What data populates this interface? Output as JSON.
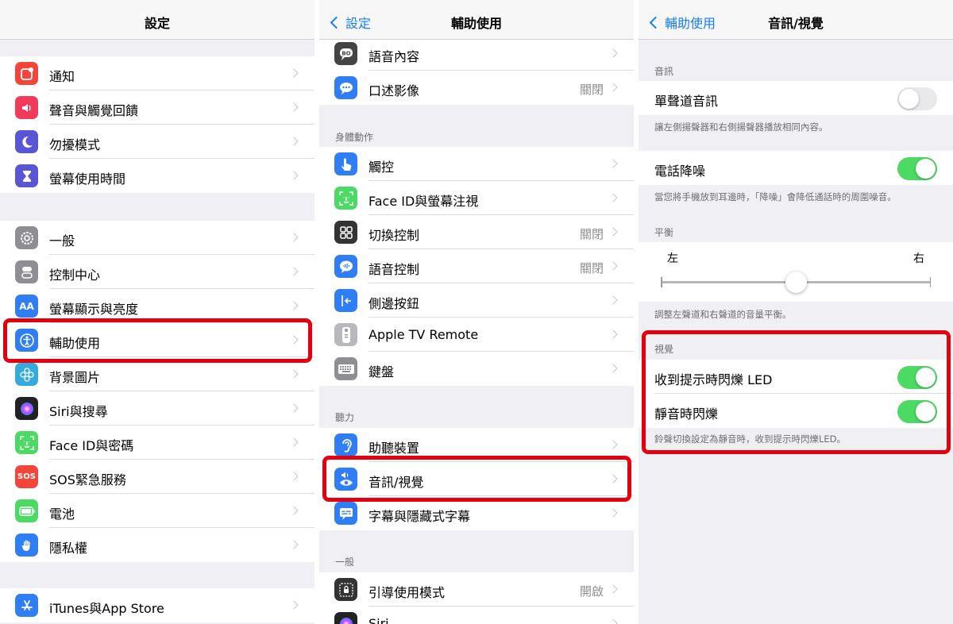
{
  "panel1": {
    "title": "設定",
    "groups": [
      [
        {
          "label": "通知",
          "icon": "notifications-icon",
          "color": "#f2463b"
        },
        {
          "label": "聲音與觸覺回饋",
          "icon": "sound-icon",
          "color": "#f23a5a"
        },
        {
          "label": "勿擾模式",
          "icon": "moon-icon",
          "color": "#5856d6"
        },
        {
          "label": "螢幕使用時間",
          "icon": "hourglass-icon",
          "color": "#5856d6"
        }
      ],
      [
        {
          "label": "一般",
          "icon": "gear-icon",
          "color": "#8e8e93"
        },
        {
          "label": "控制中心",
          "icon": "toggles-icon",
          "color": "#8e8e93"
        },
        {
          "label": "螢幕顯示與亮度",
          "icon": "display-brightness-icon",
          "color": "#2f7ef6"
        },
        {
          "label": "輔助使用",
          "icon": "accessibility-icon",
          "color": "#2f7ef6"
        },
        {
          "label": "背景圖片",
          "icon": "wallpaper-icon",
          "color": "#35aadc"
        },
        {
          "label": "Siri與搜尋",
          "icon": "siri-icon",
          "color": "#222222"
        },
        {
          "label": "Face ID與密碼",
          "icon": "face-id-icon",
          "color": "#4cd964"
        },
        {
          "label": "SOS緊急服務",
          "icon": "sos-icon",
          "color": "#f2463b"
        },
        {
          "label": "電池",
          "icon": "battery-icon",
          "color": "#4cd964"
        },
        {
          "label": "隱私權",
          "icon": "hand-icon",
          "color": "#2f7ef6"
        }
      ],
      [
        {
          "label": "iTunes與App Store",
          "icon": "app-store-icon",
          "color": "#2f7ef6"
        }
      ]
    ]
  },
  "panel2": {
    "back": "設定",
    "title": "輔助使用",
    "sections": [
      {
        "header": "",
        "items": [
          {
            "label": "語音內容",
            "icon": "speech-icon",
            "color": "#444444",
            "value": ""
          },
          {
            "label": "口述影像",
            "icon": "audio-description-icon",
            "color": "#2f7ef6",
            "value": "關閉"
          }
        ]
      },
      {
        "header": "身體動作",
        "items": [
          {
            "label": "觸控",
            "icon": "touch-icon",
            "color": "#2f7ef6",
            "value": ""
          },
          {
            "label": "Face ID與螢幕注視",
            "icon": "face-id-icon",
            "color": "#4cd964",
            "value": ""
          },
          {
            "label": "切換控制",
            "icon": "switch-control-icon",
            "color": "#333333",
            "value": "關閉"
          },
          {
            "label": "語音控制",
            "icon": "voice-control-icon",
            "color": "#2f7ef6",
            "value": "關閉"
          },
          {
            "label": "側邊按鈕",
            "icon": "side-button-icon",
            "color": "#2f7ef6",
            "value": ""
          },
          {
            "label": "Apple TV Remote",
            "icon": "remote-icon",
            "color": "#b8b8bd",
            "value": ""
          },
          {
            "label": "鍵盤",
            "icon": "keyboard-icon",
            "color": "#8e8e93",
            "value": ""
          }
        ]
      },
      {
        "header": "聽力",
        "items": [
          {
            "label": "助聽裝置",
            "icon": "ear-icon",
            "color": "#2f7ef6",
            "value": ""
          },
          {
            "label": "音訊/視覺",
            "icon": "audio-visual-icon",
            "color": "#2f7ef6",
            "value": ""
          },
          {
            "label": "字幕與隱藏式字幕",
            "icon": "captions-icon",
            "color": "#2f7ef6",
            "value": ""
          }
        ]
      },
      {
        "header": "一般",
        "items": [
          {
            "label": "引導使用模式",
            "icon": "guided-access-icon",
            "color": "#333333",
            "value": "開啟"
          },
          {
            "label": "Siri",
            "icon": "siri-icon",
            "color": "#222222",
            "value": ""
          }
        ]
      }
    ]
  },
  "panel3": {
    "back": "輔助使用",
    "title": "音訊/視覺",
    "audio_header": "音訊",
    "mono_audio": {
      "label": "單聲道音訊",
      "on": false
    },
    "mono_note": "讓左側揚聲器和右側揚聲器播放相同內容。",
    "noise_cancel": {
      "label": "電話降噪",
      "on": true
    },
    "noise_note": "當您將手機放到耳邊時，「降噪」會降低通話時的周圍噪音。",
    "balance_header": "平衡",
    "balance_left": "左",
    "balance_right": "右",
    "balance_value": 0.5,
    "balance_note": "調整左聲道和右聲道的音量平衡。",
    "visual_header": "視覺",
    "led_flash": {
      "label": "收到提示時閃爍 LED",
      "on": true
    },
    "flash_silent": {
      "label": "靜音時閃爍",
      "on": true
    },
    "visual_note": "鈴聲切換設定為靜音時，收到提示時閃爍LED。"
  },
  "highlight_color": "#e4000f"
}
